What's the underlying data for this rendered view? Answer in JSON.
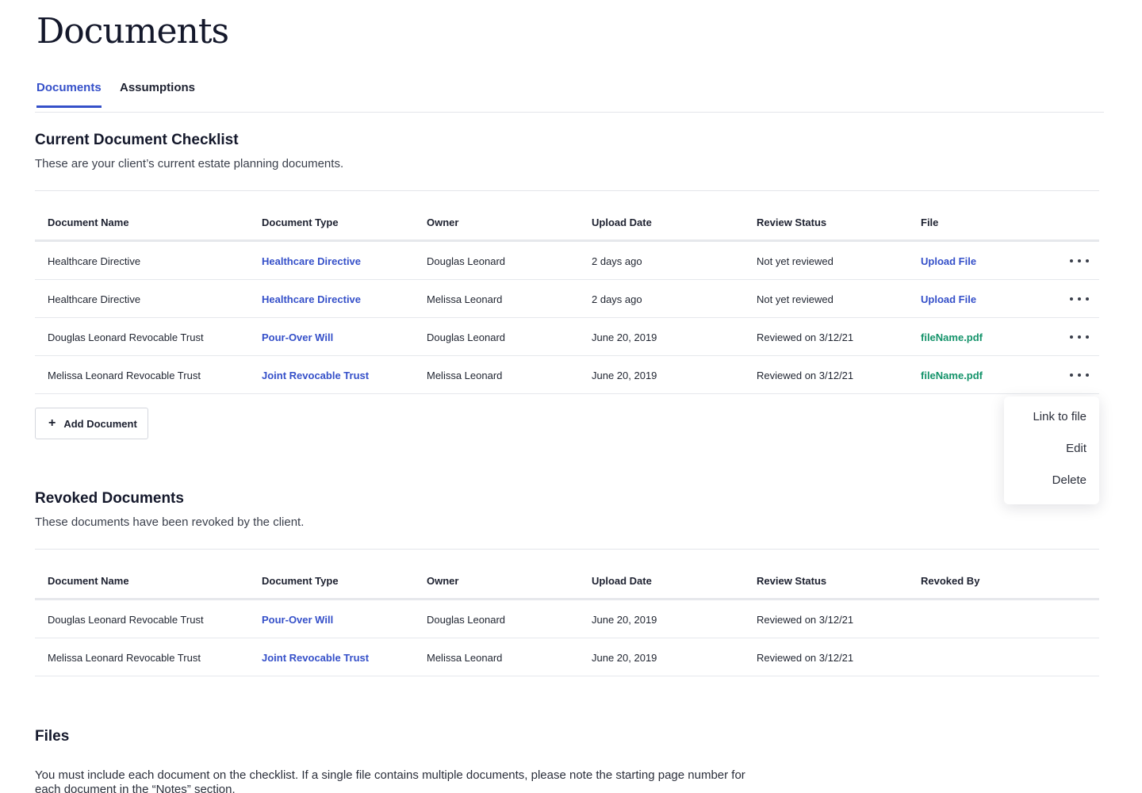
{
  "page": {
    "title": "Documents"
  },
  "tabs": [
    {
      "label": "Documents",
      "active": true
    },
    {
      "label": "Assumptions",
      "active": false
    }
  ],
  "current": {
    "title": "Current Document Checklist",
    "description": "These are your client’s current estate planning documents.",
    "columns": [
      "Document Name",
      "Document Type",
      "Owner",
      "Upload Date",
      "Review Status",
      "File"
    ],
    "rows": [
      {
        "name": "Healthcare Directive",
        "type": "Healthcare Directive",
        "owner": "Douglas Leonard",
        "date": "2 days ago",
        "status": "Not yet reviewed",
        "file": "Upload File"
      },
      {
        "name": "Healthcare Directive",
        "type": "Healthcare Directive",
        "owner": "Melissa Leonard",
        "date": "2 days ago",
        "status": "Not yet reviewed",
        "file": "Upload File"
      },
      {
        "name": "Douglas Leonard Revocable Trust",
        "type": "Pour-Over Will",
        "owner": "Douglas Leonard",
        "date": "June 20, 2019",
        "status": "Reviewed on 3/12/21",
        "file": "fileName.pdf"
      },
      {
        "name": "Melissa Leonard Revocable Trust",
        "type": "Joint Revocable Trust",
        "owner": "Melissa Leonard",
        "date": "June 20, 2019",
        "status": "Reviewed on 3/12/21",
        "file": "fileName.pdf"
      }
    ],
    "add_label": "Add Document"
  },
  "menu": {
    "items": [
      "Link to file",
      "Edit",
      "Delete"
    ]
  },
  "revoked": {
    "title": "Revoked Documents",
    "description": "These documents have been revoked by the client.",
    "columns": [
      "Document Name",
      "Document Type",
      "Owner",
      "Upload Date",
      "Review Status",
      "Revoked By"
    ],
    "rows": [
      {
        "name": "Douglas Leonard Revocable Trust",
        "type": "Pour-Over Will",
        "owner": "Douglas Leonard",
        "date": "June 20, 2019",
        "status": "Reviewed on 3/12/21",
        "revoked_by": ""
      },
      {
        "name": "Melissa Leonard Revocable Trust",
        "type": "Joint Revocable Trust",
        "owner": "Melissa Leonard",
        "date": "June 20, 2019",
        "status": "Reviewed on 3/12/21",
        "revoked_by": ""
      }
    ]
  },
  "files": {
    "title": "Files",
    "description": "You must include each document on the checklist. If a single file contains multiple documents, please note the starting page number for each document in the “Notes” section."
  },
  "colors": {
    "accent_blue": "#3550c9",
    "file_green": "#14936a"
  }
}
